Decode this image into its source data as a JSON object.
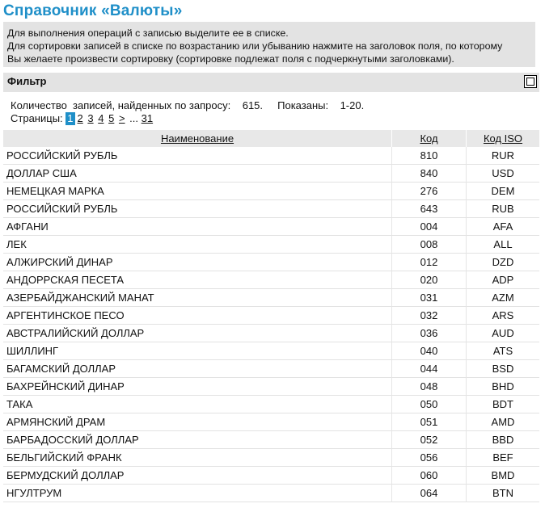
{
  "page": {
    "title": "Справочник «Валюты»"
  },
  "info": {
    "lines": [
      "Для выполнения операций с записью выделите ее в списке.",
      "Для сортировки записей в списке по возрастанию или убыванию нажмите на заголовок поля, по которому",
      "Вы желаете произвести сортировку (сортировке подлежат поля с подчеркнутыми заголовками)."
    ]
  },
  "filter": {
    "label": "Фильтр"
  },
  "summary": {
    "count_label": "Количество  записей, найденных по запросу:",
    "count_value": "615.",
    "shown_label": "Показаны:",
    "shown_value": "1-20."
  },
  "pagination": {
    "label": "Страницы:",
    "current": "1",
    "pages": [
      "2",
      "3",
      "4",
      "5"
    ],
    "next": ">",
    "ellipsis": "...",
    "last": "31"
  },
  "table": {
    "columns": [
      "Наименование",
      "Код",
      "Код ISO"
    ],
    "rows": [
      [
        "РОССИЙСКИЙ РУБЛЬ",
        "810",
        "RUR"
      ],
      [
        "ДОЛЛАР США",
        "840",
        "USD"
      ],
      [
        "НЕМЕЦКАЯ МАРКА",
        "276",
        "DEM"
      ],
      [
        "РОССИЙСКИЙ РУБЛЬ",
        "643",
        "RUB"
      ],
      [
        "АФГАНИ",
        "004",
        "AFA"
      ],
      [
        "ЛЕК",
        "008",
        "ALL"
      ],
      [
        "АЛЖИРСКИЙ ДИНАР",
        "012",
        "DZD"
      ],
      [
        "АНДОРРСКАЯ ПЕСЕТА",
        "020",
        "ADP"
      ],
      [
        "АЗЕРБАЙДЖАНСКИЙ МАНАТ",
        "031",
        "AZM"
      ],
      [
        "АРГЕНТИНСКОЕ ПЕСО",
        "032",
        "ARS"
      ],
      [
        "АВСТРАЛИЙСКИЙ ДОЛЛАР",
        "036",
        "AUD"
      ],
      [
        "ШИЛЛИНГ",
        "040",
        "ATS"
      ],
      [
        "БАГАМСКИЙ ДОЛЛАР",
        "044",
        "BSD"
      ],
      [
        "БАХРЕЙНСКИЙ ДИНАР",
        "048",
        "BHD"
      ],
      [
        "ТАКА",
        "050",
        "BDT"
      ],
      [
        "АРМЯНСКИЙ ДРАМ",
        "051",
        "AMD"
      ],
      [
        "БАРБАДОССКИЙ ДОЛЛАР",
        "052",
        "BBD"
      ],
      [
        "БЕЛЬГИЙСКИЙ ФРАНК",
        "056",
        "BEF"
      ],
      [
        "БЕРМУДСКИЙ ДОЛЛАР",
        "060",
        "BMD"
      ],
      [
        "НГУЛТРУМ",
        "064",
        "BTN"
      ]
    ]
  },
  "colors": {
    "accent": "#1f8fc8",
    "panel_bg": "#e3e3e3"
  },
  "icons": {
    "filter_toggle": "collapse-square-icon"
  }
}
